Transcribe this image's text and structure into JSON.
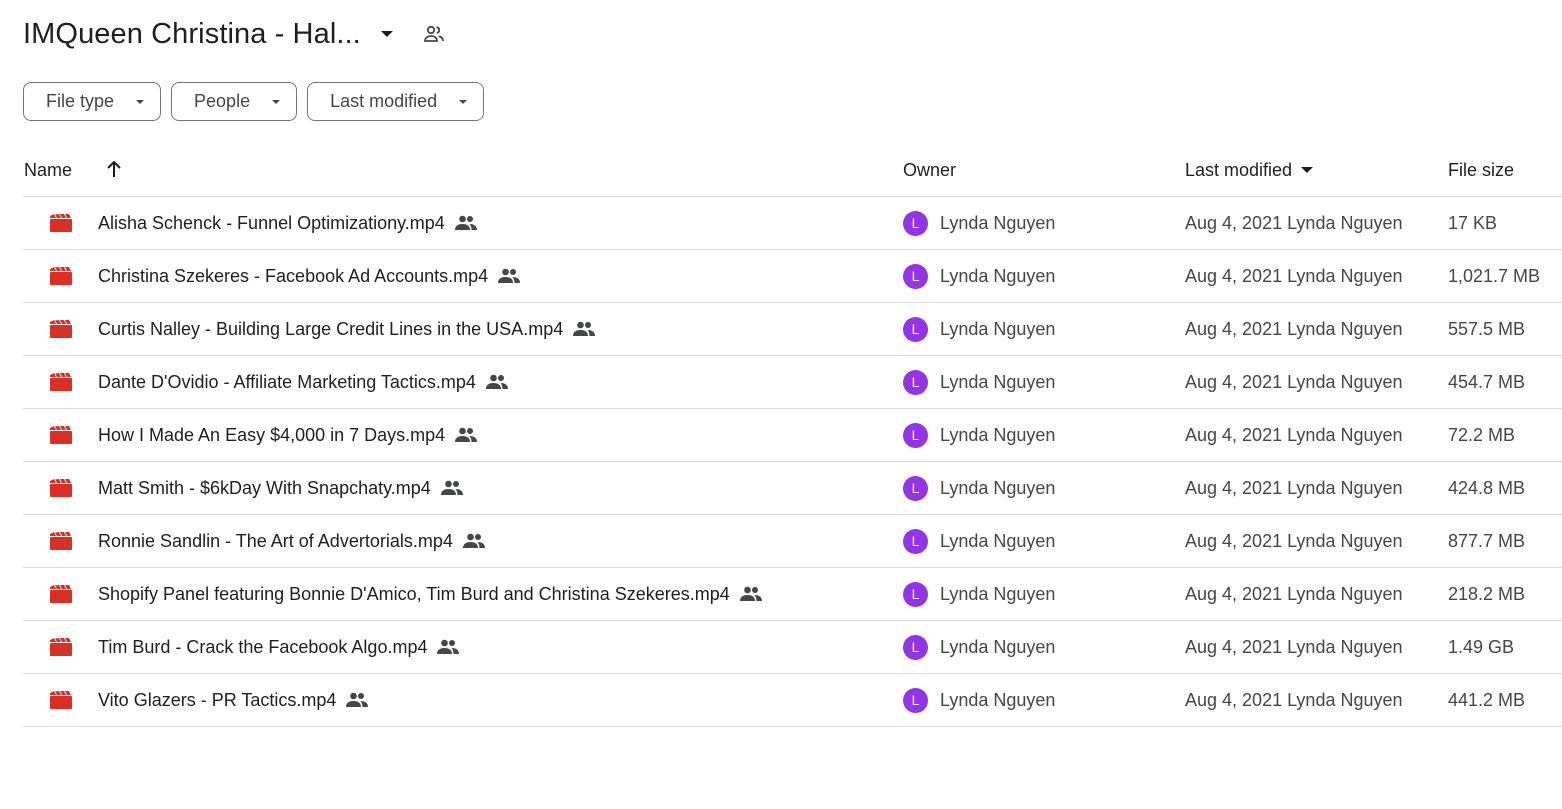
{
  "folder": {
    "title": "IMQueen Christina - Hal...",
    "caret_icon": "arrow-drop-down-icon",
    "shared_icon": "people-outline-icon"
  },
  "filters": [
    {
      "label": "File type"
    },
    {
      "label": "People"
    },
    {
      "label": "Last modified"
    }
  ],
  "columns": {
    "name": "Name",
    "owner": "Owner",
    "last_modified": "Last modified",
    "file_size": "File size"
  },
  "sort": {
    "column": "name",
    "direction": "ascending"
  },
  "colors": {
    "video_icon": "#d93025",
    "avatar_bg": "#9334e6",
    "divider": "#dadce0",
    "text": "#1f1f1f"
  },
  "files": [
    {
      "name": "Alisha Schenck - Funnel Optimizationy.mp4",
      "owner": "Lynda Nguyen",
      "owner_initial": "L",
      "modified": "Aug 4, 2021 Lynda Nguyen",
      "size": "17 KB"
    },
    {
      "name": "Christina Szekeres - Facebook Ad Accounts.mp4",
      "owner": "Lynda Nguyen",
      "owner_initial": "L",
      "modified": "Aug 4, 2021 Lynda Nguyen",
      "size": "1,021.7 MB"
    },
    {
      "name": "Curtis Nalley - Building Large Credit Lines in the USA.mp4",
      "owner": "Lynda Nguyen",
      "owner_initial": "L",
      "modified": "Aug 4, 2021 Lynda Nguyen",
      "size": "557.5 MB"
    },
    {
      "name": "Dante D'Ovidio - Affiliate Marketing Tactics.mp4",
      "owner": "Lynda Nguyen",
      "owner_initial": "L",
      "modified": "Aug 4, 2021 Lynda Nguyen",
      "size": "454.7 MB"
    },
    {
      "name": "How I Made An Easy $4,000 in 7 Days.mp4",
      "owner": "Lynda Nguyen",
      "owner_initial": "L",
      "modified": "Aug 4, 2021 Lynda Nguyen",
      "size": "72.2 MB"
    },
    {
      "name": "Matt Smith - $6kDay With Snapchaty.mp4",
      "owner": "Lynda Nguyen",
      "owner_initial": "L",
      "modified": "Aug 4, 2021 Lynda Nguyen",
      "size": "424.8 MB"
    },
    {
      "name": "Ronnie Sandlin - The Art of Advertorials.mp4",
      "owner": "Lynda Nguyen",
      "owner_initial": "L",
      "modified": "Aug 4, 2021 Lynda Nguyen",
      "size": "877.7 MB"
    },
    {
      "name": "Shopify Panel featuring Bonnie D'Amico, Tim Burd and Christina Szekeres.mp4",
      "owner": "Lynda Nguyen",
      "owner_initial": "L",
      "modified": "Aug 4, 2021 Lynda Nguyen",
      "size": "218.2 MB"
    },
    {
      "name": "Tim Burd - Crack the Facebook Algo.mp4",
      "owner": "Lynda Nguyen",
      "owner_initial": "L",
      "modified": "Aug 4, 2021 Lynda Nguyen",
      "size": "1.49 GB"
    },
    {
      "name": "Vito Glazers - PR Tactics.mp4",
      "owner": "Lynda Nguyen",
      "owner_initial": "L",
      "modified": "Aug 4, 2021 Lynda Nguyen",
      "size": "441.2 MB"
    }
  ]
}
